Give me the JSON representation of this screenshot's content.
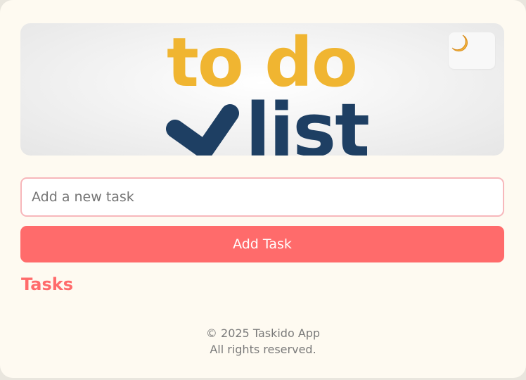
{
  "banner": {
    "logo_line1": "to do",
    "logo_line2": "list"
  },
  "theme_toggle": {
    "icon": "crescent-moon-icon"
  },
  "task_input": {
    "value": "",
    "placeholder": "Add a new task"
  },
  "add_button": {
    "label": "Add Task"
  },
  "tasks_section": {
    "heading": "Tasks",
    "items": []
  },
  "footer": {
    "copyright": "© 2025 Taskido App",
    "rights": "All rights reserved."
  },
  "colors": {
    "accent": "#ff6b6b",
    "background": "#fefaf1",
    "logo_yellow": "#f0b531",
    "logo_navy": "#1e3f63",
    "input_border": "#f7b7bb"
  }
}
